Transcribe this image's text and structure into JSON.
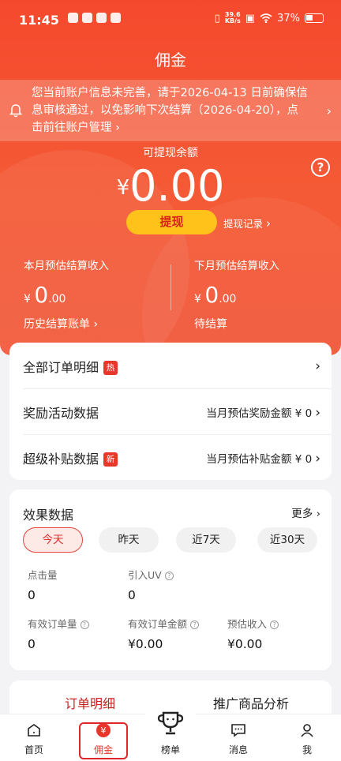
{
  "status_bar": {
    "time": "11:45",
    "net_speed_value": "39.6",
    "net_speed_unit": "KB/s",
    "battery": "37%"
  },
  "page_title": "佣金",
  "notice": {
    "text": "您当前账户信息未完善，请于2026-04-13 日前确保信息审核通过，以免影响下次结算（2026-04-20），点击前往账户管理"
  },
  "balance": {
    "label": "可提现余额",
    "currency": "¥",
    "amount": "0.00",
    "withdraw_label": "提现",
    "record_label": "提现记录"
  },
  "estimates": {
    "this_month": {
      "label": "本月预估结算收入",
      "currency": "¥",
      "int": "0",
      "dec": ".00",
      "link": "历史结算账单"
    },
    "next_month": {
      "label": "下月预估结算收入",
      "currency": "¥",
      "int": "0",
      "dec": ".00",
      "link": "待结算"
    }
  },
  "list_rows": [
    {
      "name": "全部订单明细",
      "tag": "热",
      "right": ""
    },
    {
      "name": "奖励活动数据",
      "tag": "",
      "right": "当月预估奖励金额 ¥ 0"
    },
    {
      "name": "超级补贴数据",
      "tag": "新",
      "right": "当月预估补贴金额 ¥ 0"
    }
  ],
  "effect": {
    "title": "效果数据",
    "more": "更多",
    "filters": [
      "今天",
      "昨天",
      "近7天",
      "近30天"
    ],
    "active_filter": "今天",
    "metrics": [
      {
        "label": "点击量",
        "value": "0",
        "help": false
      },
      {
        "label": "引入UV",
        "value": "0",
        "help": true
      },
      {
        "label": "有效订单量",
        "value": "0",
        "help": true
      },
      {
        "label": "有效订单金额",
        "value": "¥0.00",
        "help": true
      },
      {
        "label": "预估收入",
        "value": "¥0.00",
        "help": true
      }
    ]
  },
  "bottom_tabs": {
    "order_detail": "订单明细",
    "product_analysis": "推广商品分析"
  },
  "tabbar": [
    {
      "label": "首页",
      "icon": "home-icon"
    },
    {
      "label": "佣金",
      "icon": "yen-icon"
    },
    {
      "label": "榜单",
      "icon": "trophy-icon"
    },
    {
      "label": "消息",
      "icon": "message-icon"
    },
    {
      "label": "我",
      "icon": "person-icon"
    }
  ],
  "colors": {
    "accent": "#f4482c",
    "button_yellow": "#ffc21a",
    "tag_red": "#e8362a",
    "highlight": "#e0262a"
  }
}
